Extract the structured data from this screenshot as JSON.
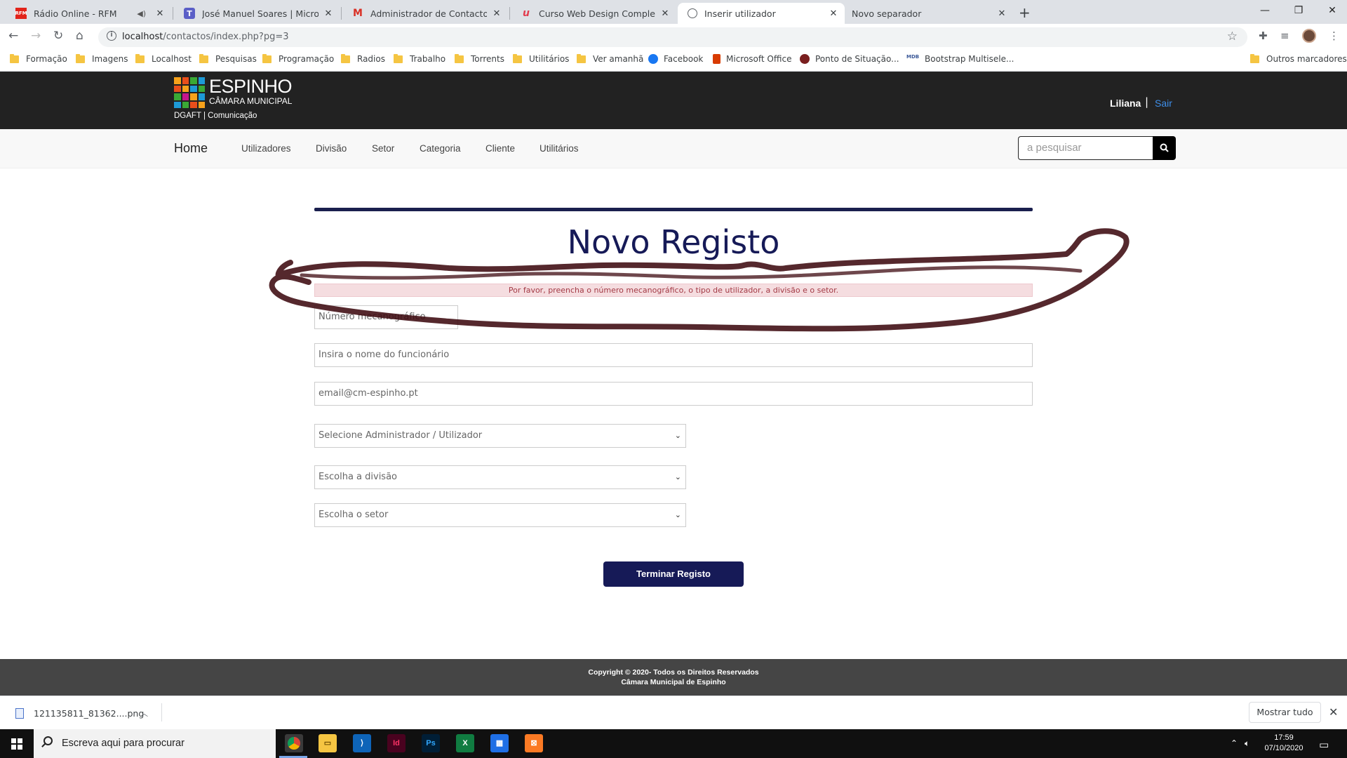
{
  "browser": {
    "tabs": [
      {
        "title": "Rádio Online - RFM",
        "icon": "rfm-icon",
        "audio": true
      },
      {
        "title": "José Manuel Soares | Microsoft Te",
        "icon": "teams-icon"
      },
      {
        "title": "Administrador de Contactos - lilia",
        "icon": "gmail-icon"
      },
      {
        "title": "Curso Web Design Completo: HT",
        "icon": "udemy-icon"
      },
      {
        "title": "Inserir utilizador",
        "icon": "globe-icon",
        "active": true
      },
      {
        "title": "Novo separador",
        "icon": "none"
      }
    ],
    "url": {
      "host": "localhost",
      "path": "/contactos/index.php?pg=3"
    },
    "bookmarks": [
      {
        "label": "Formação",
        "icon": "folder-icon"
      },
      {
        "label": "Imagens",
        "icon": "folder-icon"
      },
      {
        "label": "Localhost",
        "icon": "folder-icon"
      },
      {
        "label": "Pesquisas",
        "icon": "folder-icon"
      },
      {
        "label": "Programação",
        "icon": "folder-icon"
      },
      {
        "label": "Radios",
        "icon": "folder-icon"
      },
      {
        "label": "Trabalho",
        "icon": "folder-icon"
      },
      {
        "label": "Torrents",
        "icon": "folder-icon"
      },
      {
        "label": "Utilitários",
        "icon": "folder-icon"
      },
      {
        "label": "Ver amanhã",
        "icon": "folder-icon"
      },
      {
        "label": "Facebook",
        "icon": "facebook-icon"
      },
      {
        "label": "Microsoft Office",
        "icon": "office-icon"
      },
      {
        "label": "Ponto de Situação...",
        "icon": "site-icon"
      },
      {
        "label": "Bootstrap Multisele...",
        "icon": "mdb-icon"
      }
    ],
    "other_bookmarks": "Outros marcadores"
  },
  "site": {
    "logo_name": "ESPINHO",
    "logo_sub": "CÂMARA MUNICIPAL",
    "org_label": "DGAFT | Comunicação",
    "user": "Liliana",
    "user_sep": "|",
    "logout": "Sair",
    "nav": {
      "home": "Home",
      "items": [
        "Utilizadores",
        "Divisão",
        "Setor",
        "Categoria",
        "Cliente",
        "Utilitários"
      ]
    },
    "search_placeholder": "a pesquisar"
  },
  "form": {
    "title": "Novo Registo",
    "alert": "Por favor, preencha o número mecanográfico, o tipo de utilizador, a divisão e o setor.",
    "mec_placeholder": "Número mecanográfico",
    "name_placeholder": "Insira o nome do funcionário",
    "email_placeholder": "email@cm-espinho.pt",
    "select_type": "Selecione Administrador / Utilizador",
    "select_division": "Escolha a divisão",
    "select_sector": "Escolha o setor",
    "submit": "Terminar Registo"
  },
  "footer": {
    "line1": "Copyright © 2020- Todos os Direitos Reservados",
    "line2": "Câmara Municipal de Espinho"
  },
  "downloads": {
    "file": "121135811_81362....png",
    "show_all": "Mostrar tudo"
  },
  "taskbar": {
    "search_text": "Escreva aqui para procurar",
    "time": "17:59",
    "date": "07/10/2020",
    "apps": [
      "chrome-icon",
      "file-explorer-icon",
      "vscode-icon",
      "indesign-icon",
      "photoshop-icon",
      "excel-icon",
      "calendar-icon",
      "xampp-icon"
    ]
  },
  "colors": {
    "header_bg": "#222222",
    "accent_navy": "#161a57",
    "alert_bg": "#f5dde0",
    "alert_text": "#a33a45",
    "link_blue": "#3e8ee8",
    "footer_bg": "#454545"
  }
}
